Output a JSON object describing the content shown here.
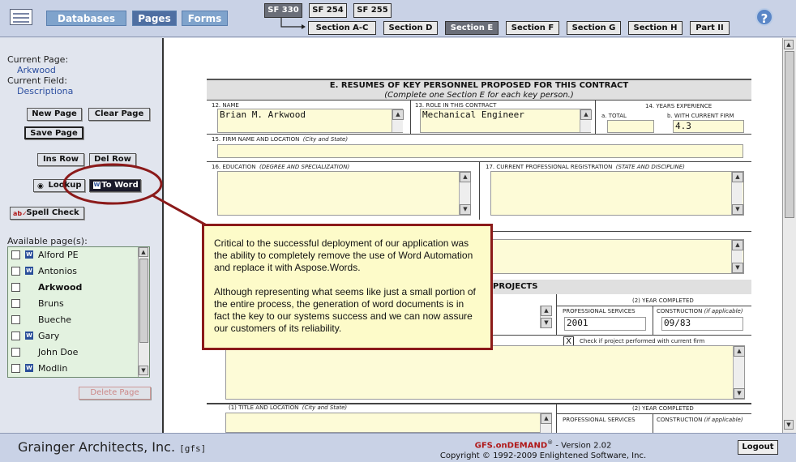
{
  "nav": {
    "databases": "Databases",
    "pages": "Pages",
    "forms": "Forms"
  },
  "form_tabs": [
    "SF 330",
    "SF 254",
    "SF 255"
  ],
  "section_tabs": [
    "Section A-C",
    "Section D",
    "Section E",
    "Section F",
    "Section G",
    "Section H",
    "Part II"
  ],
  "help_label": "?",
  "sidebar": {
    "current_page_label": "Current Page:",
    "current_page": "Arkwood",
    "current_field_label": "Current Field:",
    "current_field": "Descriptiona",
    "new_page": "New Page",
    "clear_page": "Clear Page",
    "save_page": "Save Page",
    "ins_row": "Ins Row",
    "del_row": "Del Row",
    "lookup": "Lookup",
    "to_word": "To Word",
    "spell_check": "Spell Check",
    "available_label": "Available page(s):",
    "pages": [
      "Alford PE",
      "Antonios",
      "Arkwood",
      "Bruns",
      "Bueche",
      "Gary",
      "John Doe",
      "Modlin"
    ],
    "delete_page": "Delete Page"
  },
  "doc": {
    "title": "E. RESUMES OF KEY PERSONNEL PROPOSED FOR THIS CONTRACT",
    "subtitle": "(Complete one Section E for each key person.)",
    "name_label": "12. NAME",
    "name_value": "Brian M. Arkwood",
    "role_label": "13. ROLE IN THIS CONTRACT",
    "role_value": "Mechanical Engineer",
    "years_label": "14. YEARS EXPERIENCE",
    "total_label": "a. TOTAL",
    "current_firm_label": "b. WITH CURRENT FIRM",
    "current_firm_value": "4.3",
    "firm_label": "15. FIRM NAME AND LOCATION",
    "firm_hint": "(City and State)",
    "edu_label": "16. EDUCATION",
    "edu_hint": "(DEGREE AND SPECIALIZATION)",
    "reg_label": "17. CURRENT PROFESSIONAL REGISTRATION",
    "reg_hint": "(STATE AND DISCIPLINE)",
    "projects_label": "PROJECTS",
    "year_completed": "(2) YEAR COMPLETED",
    "prof_services": "PROFESSIONAL SERVICES",
    "construction": "CONSTRUCTION",
    "if_applicable": "(if applicable)",
    "prof_value": "2001",
    "constr_value": "09/83",
    "check_label": "Check if project performed with current firm",
    "check_mark": "X",
    "title_loc_label": "(1) TITLE AND LOCATION",
    "title_loc_hint": "(City and State)"
  },
  "callout": {
    "p1": "Critical to the successful deployment of our application was the ability to completely remove the use of Word Automation and replace it with Aspose.Words.",
    "p2": "Although representing what seems like just a small portion of the entire process, the generation of word documents is in fact the key to our systems success and we can now assure our customers of its reliability."
  },
  "footer": {
    "company": "Grainger Architects, Inc.",
    "company_code": "[gfs]",
    "brand": "GFS.onDEMAND",
    "reg": "®",
    "version": " - Version 2.02",
    "copyright": "Copyright © 1992-2009 Enlightened Software, Inc.",
    "logout": "Logout"
  },
  "colors": {
    "callout_border": "#8b1a1a",
    "callout_bg": "#fdfbc9",
    "field_bg": "#fdfbd7",
    "nav_button": "#7fa3cc"
  }
}
